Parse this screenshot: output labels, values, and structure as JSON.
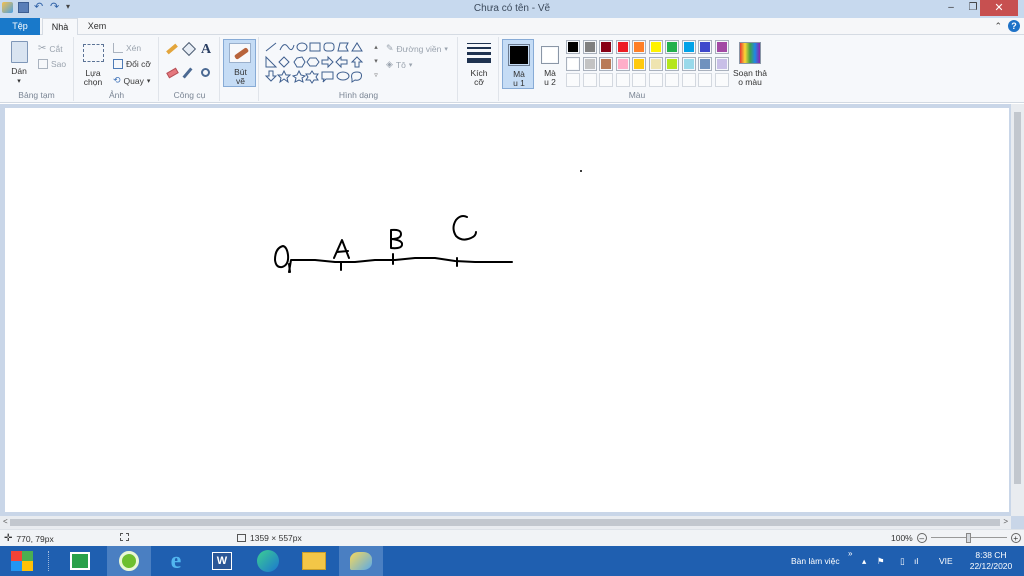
{
  "window": {
    "title": "Chưa có tên - Vẽ",
    "minimize_glyph": "–",
    "restore_glyph": "❐",
    "close_glyph": "✕"
  },
  "tabs": [
    {
      "label": "Tệp"
    },
    {
      "label": "Nhà"
    },
    {
      "label": "Xem"
    }
  ],
  "ribbon": {
    "clipboard": {
      "paste_label": "Dán",
      "cut_label": "Cắt",
      "copy_label": "Sao",
      "group_label": "Bảng tạm"
    },
    "image": {
      "select_label_line1": "Lựa",
      "select_label_line2": "chọn",
      "crop_label": "Xén",
      "resize_label": "Đổi cỡ",
      "rotate_label": "Quay",
      "group_label": "Ảnh"
    },
    "tools": {
      "group_label": "Công cụ",
      "text_tool_glyph": "A"
    },
    "brushes": {
      "label_line1": "Bút",
      "label_line2": "vẽ"
    },
    "shapes": {
      "outline_label": "Đường viền",
      "fill_label": "Tô",
      "group_label": "Hình dạng"
    },
    "size": {
      "label_line1": "Kích",
      "label_line2": "cỡ"
    },
    "colors": {
      "color1_line1": "Mà",
      "color1_line2": "u 1",
      "color2_line1": "Mà",
      "color2_line2": "u 2",
      "edit_line1": "Soạn thả",
      "edit_line2": "o màu",
      "group_label": "Màu",
      "color1_value": "#000000",
      "color2_value": "#ffffff",
      "palette_row1": [
        "#000000",
        "#7f7f7f",
        "#880015",
        "#ed1c24",
        "#ff7f27",
        "#fff200",
        "#22b14c",
        "#00a2e8",
        "#3f48cc",
        "#a349a4"
      ],
      "palette_row2": [
        "#ffffff",
        "#c3c3c3",
        "#b97a57",
        "#ffaec9",
        "#ffc90e",
        "#efe4b0",
        "#b5e61d",
        "#99d9ea",
        "#7092be",
        "#c8bfe7"
      ]
    }
  },
  "drawing": {
    "labels": [
      "O",
      "A",
      "B",
      "C"
    ]
  },
  "statusbar": {
    "cursor_pos": "770, 79px",
    "canvas_size": "1359 × 557px",
    "zoom": "100%"
  },
  "taskbar": {
    "desktop_label": "Bàn làm việc",
    "lang": "VIE",
    "time": "8:38 CH",
    "date": "22/12/2020",
    "chevron": "»"
  }
}
